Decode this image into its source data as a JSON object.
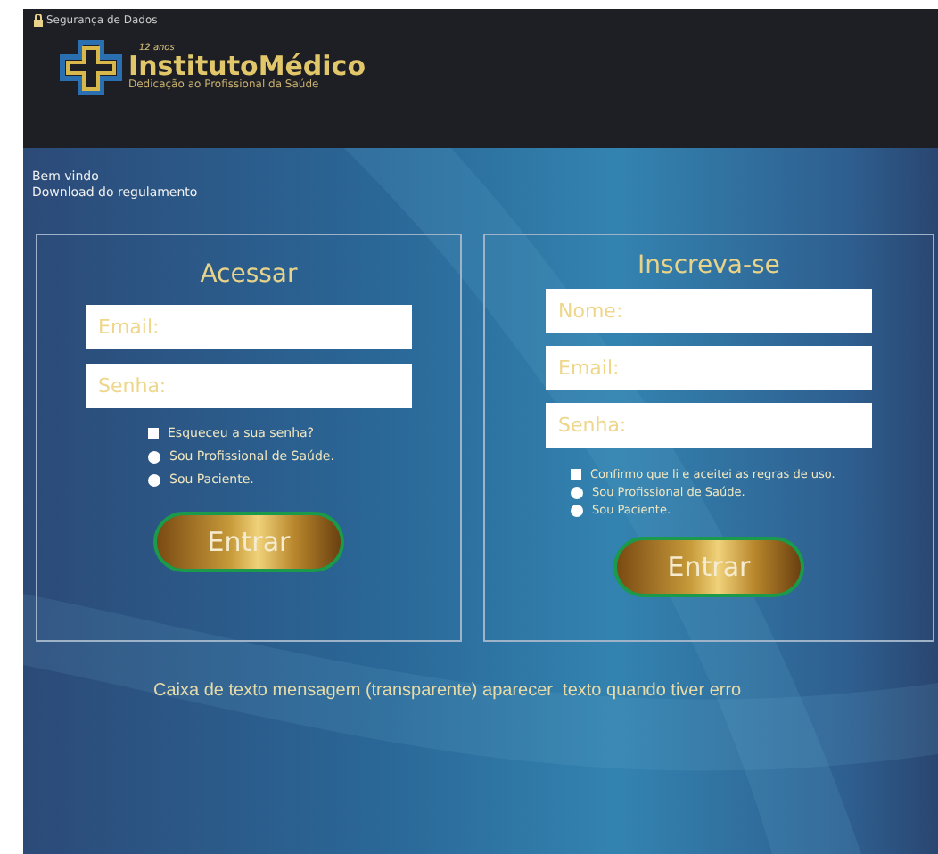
{
  "header": {
    "security_note": "Segurança de Dados",
    "logo": {
      "years": "12 anos",
      "name": "InstitutoMédico",
      "tagline": "Dedicação ao Profissional da Saúde"
    }
  },
  "links": [
    "Bem vindo",
    "Download do regulamento"
  ],
  "panels": [
    {
      "title": "Acessar",
      "fields": [
        {
          "placeholder": "Email:"
        },
        {
          "placeholder": "Senha:"
        }
      ],
      "options": [
        {
          "kind": "checkbox",
          "label": "Esqueceu a sua senha?",
          "checked": false
        },
        {
          "kind": "radio",
          "label": "Sou Profissional de Saúde.",
          "checked": false
        },
        {
          "kind": "radio",
          "label": "Sou Paciente.",
          "checked": false
        }
      ],
      "button": "Entrar"
    },
    {
      "title": "Inscreva-se",
      "fields": [
        {
          "placeholder": "Nome:"
        },
        {
          "placeholder": "Email:"
        },
        {
          "placeholder": "Senha:"
        }
      ],
      "options": [
        {
          "kind": "checkbox",
          "label": "Confirmo que li e aceitei as regras de uso.",
          "checked": false
        },
        {
          "kind": "radio",
          "label": "Sou Profissional de Saúde.",
          "checked": false
        },
        {
          "kind": "radio",
          "label": "Sou Paciente.",
          "checked": false
        }
      ],
      "button": "Entrar"
    }
  ],
  "message": "Caixa de texto mensagem (transparente) aparecer  texto quando tiver erro"
}
